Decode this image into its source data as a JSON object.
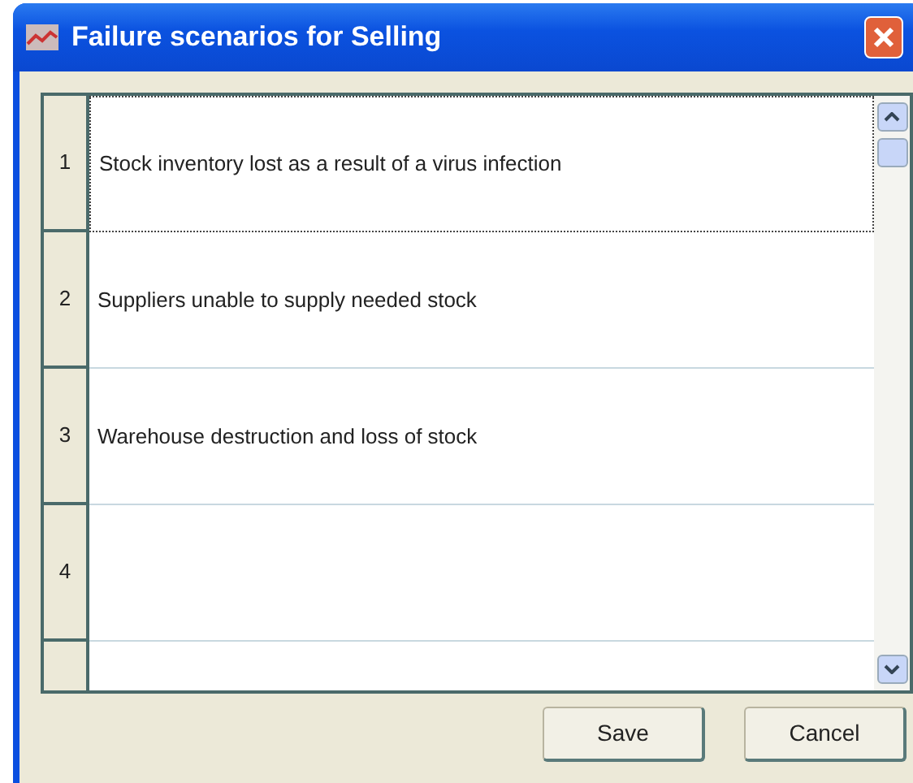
{
  "window": {
    "title": "Failure scenarios for Selling"
  },
  "rows": [
    {
      "number": "1",
      "text": "Stock inventory lost as a result of a virus infection",
      "selected": true
    },
    {
      "number": "2",
      "text": "Suppliers unable to supply needed stock",
      "selected": false
    },
    {
      "number": "3",
      "text": "Warehouse destruction and loss of stock",
      "selected": false
    },
    {
      "number": "4",
      "selected": false
    }
  ],
  "buttons": [
    {
      "label": "Save"
    },
    {
      "label": "Cancel"
    }
  ]
}
